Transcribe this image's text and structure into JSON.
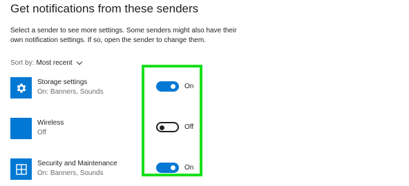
{
  "page": {
    "heading": "Get notifications from these senders",
    "description": "Select a sender to see more settings. Some senders might also have their own notification settings. If so, open the sender to change them."
  },
  "sort": {
    "label": "Sort by:",
    "value": "Most recent"
  },
  "senders": [
    {
      "name": "Storage settings",
      "status": "On: Banners, Sounds",
      "toggle_label": "On",
      "enabled": true,
      "icon": "gear-icon"
    },
    {
      "name": "Wireless",
      "status": "Off",
      "toggle_label": "Off",
      "enabled": false,
      "icon": "blank-app-icon"
    },
    {
      "name": "Security and Maintenance",
      "status": "On: Banners, Sounds",
      "toggle_label": "On",
      "enabled": true,
      "icon": "security-maintenance-icon"
    }
  ],
  "colors": {
    "accent": "#0078d4",
    "highlight": "#17e01a"
  }
}
